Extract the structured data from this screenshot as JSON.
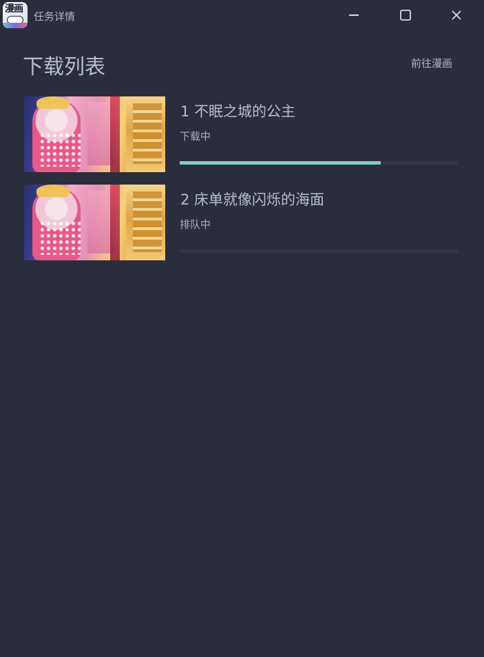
{
  "window": {
    "title": "任务详情",
    "app_icon_text": "漫画"
  },
  "header": {
    "title": "下载列表",
    "goto_label": "前往漫画"
  },
  "tasks": [
    {
      "title": "1 不眠之城的公主",
      "status": "下载中",
      "progress": 0.72
    },
    {
      "title": "2 床单就像闪烁的海面",
      "status": "排队中",
      "progress": 0.0
    }
  ],
  "colors": {
    "background": "#2a2d3c",
    "progress_fill": "#7ecfc2",
    "progress_track": "#333749"
  }
}
